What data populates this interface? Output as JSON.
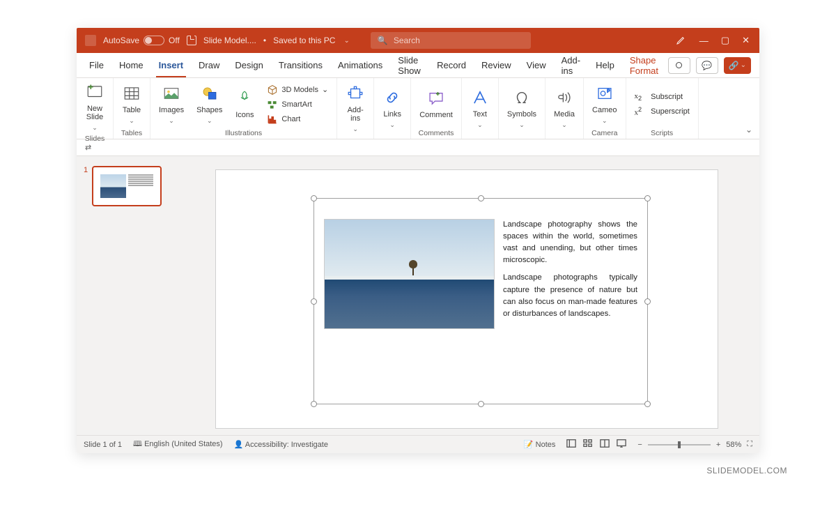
{
  "titlebar": {
    "autosave_label": "AutoSave",
    "autosave_state": "Off",
    "doc_name": "Slide Model....",
    "save_status": "Saved to this PC",
    "search_placeholder": "Search"
  },
  "menu": {
    "items": [
      "File",
      "Home",
      "Insert",
      "Draw",
      "Design",
      "Transitions",
      "Animations",
      "Slide Show",
      "Record",
      "Review",
      "View",
      "Add-ins",
      "Help"
    ],
    "context_tab": "Shape Format"
  },
  "ribbon": {
    "groups": {
      "slides": {
        "label": "Slides",
        "new_slide": "New\nSlide"
      },
      "tables": {
        "label": "Tables",
        "table": "Table"
      },
      "illustrations": {
        "label": "Illustrations",
        "images": "Images",
        "shapes": "Shapes",
        "icons": "Icons",
        "models3d": "3D Models",
        "smartart": "SmartArt",
        "chart": "Chart"
      },
      "addins": {
        "label": "",
        "addins": "Add-\nins"
      },
      "links": {
        "label": "",
        "links": "Links"
      },
      "comments": {
        "label": "Comments",
        "comment": "Comment"
      },
      "text": {
        "label": "",
        "text": "Text"
      },
      "symbols": {
        "label": "",
        "symbols": "Symbols"
      },
      "media": {
        "label": "",
        "media": "Media"
      },
      "camera": {
        "label": "Camera",
        "cameo": "Cameo"
      },
      "scripts": {
        "label": "Scripts",
        "subscript": "Subscript",
        "superscript": "Superscript"
      }
    }
  },
  "thumb": {
    "number": "1"
  },
  "slide": {
    "para1": "Landscape photography shows the spaces within the world, sometimes vast and unending, but other times microscopic.",
    "para2": "Landscape photographs typically capture the presence of nature but can also focus on man-made features or disturbances of landscapes."
  },
  "status": {
    "slide_info": "Slide 1 of 1",
    "language": "English (United States)",
    "accessibility": "Accessibility: Investigate",
    "notes": "Notes",
    "zoom": "58%"
  },
  "watermark": "SLIDEMODEL.COM"
}
